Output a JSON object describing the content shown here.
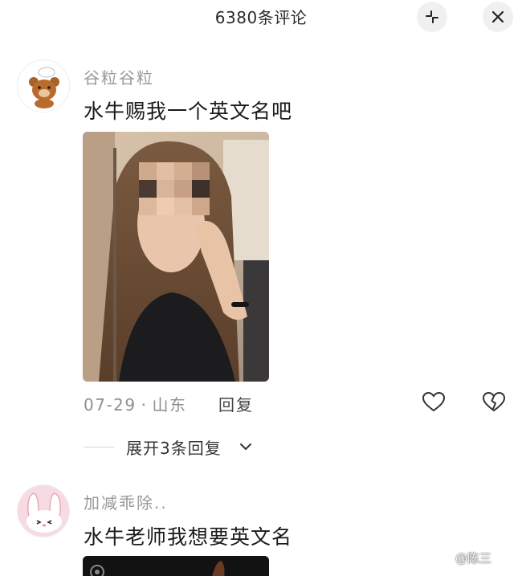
{
  "header": {
    "title": "6380条评论",
    "collapse_icon": "collapse-icon",
    "close_icon": "close-icon"
  },
  "comments": [
    {
      "username": "谷粒谷粒",
      "text": "水牛赐我一个英文名吧",
      "avatar_icon": "bear-chef-avatar",
      "has_photo": true,
      "date": "07-29",
      "separator": "·",
      "location": "山东",
      "reply_label": "回复",
      "like_icon": "heart-icon",
      "dislike_icon": "broken-heart-icon",
      "expand_label": "展开3条回复"
    },
    {
      "username": "加减乖除..",
      "text": "水牛老师我想要英文名",
      "avatar_icon": "bunny-avatar",
      "has_photo": true
    }
  ],
  "watermark": "@陈三",
  "colors": {
    "text_primary": "#1a1a1a",
    "text_secondary": "#9a9a9a",
    "button_bg": "#f0f0f0"
  }
}
